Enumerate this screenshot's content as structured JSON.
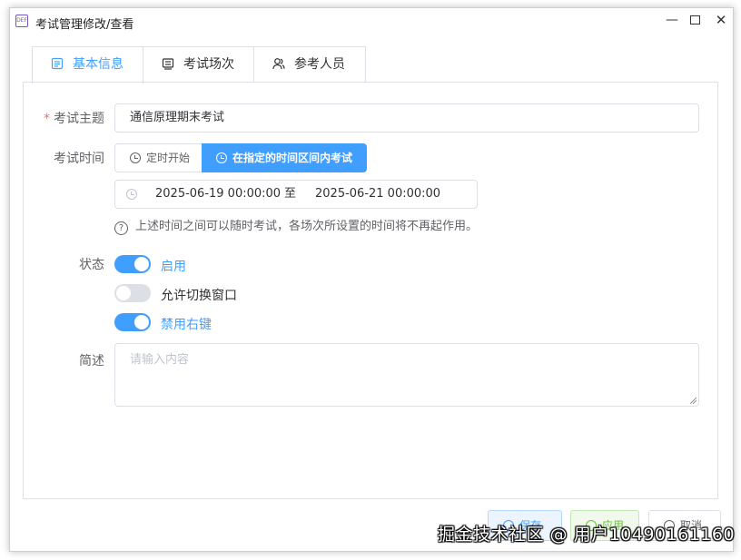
{
  "window": {
    "title": "考试管理修改/查看",
    "app_icon_text": "DEF",
    "icons": {
      "minimize": "minimize-icon",
      "maximize": "maximize-icon",
      "close": "close-icon"
    }
  },
  "tabs": [
    {
      "label": "基本信息",
      "icon": "document-list-icon",
      "active": true
    },
    {
      "label": "考试场次",
      "icon": "list-icon",
      "active": false
    },
    {
      "label": "参考人员",
      "icon": "users-icon",
      "active": false
    }
  ],
  "form": {
    "subject": {
      "label": "考试主题",
      "value": "通信原理期末考试",
      "required": true
    },
    "time": {
      "label": "考试时间",
      "modes": [
        "定时开始",
        "在指定的时间区间内考试"
      ],
      "selected_mode": "在指定的时间区间内考试",
      "start": "2025-06-19 00:00:00",
      "separator": "至",
      "end": "2025-06-21 00:00:00",
      "hint": "上述时间之间可以随时考试，各场次所设置的时间将不再起作用。"
    },
    "status": {
      "label": "状态",
      "switches": [
        {
          "label": "启用",
          "on": true
        },
        {
          "label": "允许切换窗口",
          "on": false
        },
        {
          "label": "禁用右键",
          "on": true
        }
      ]
    },
    "description": {
      "label": "简述",
      "placeholder": "请输入内容",
      "value": ""
    }
  },
  "buttons": {
    "save": "保存",
    "apply": "应用",
    "cancel": "取消"
  },
  "watermark": "掘金技术社区 @ 用户10490161160",
  "colors": {
    "accent": "#409eff",
    "success": "#67c23a",
    "required": "#f56c6c"
  }
}
